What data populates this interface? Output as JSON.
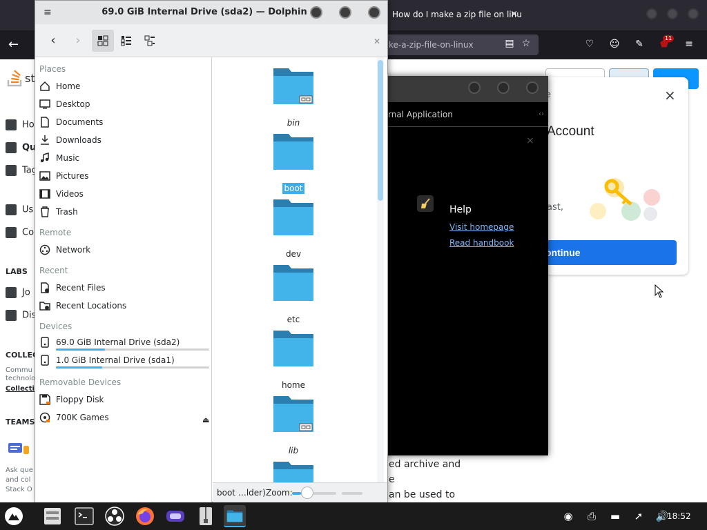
{
  "firefox": {
    "tab_title": "How do I make a zip file on linu",
    "tab_close": "×",
    "url_fragment": "ke-a-zip-file-on-linux",
    "extension_badge": "11",
    "back_arrow": "←"
  },
  "stackoverflow": {
    "logo_text": "st",
    "sidebar": [
      {
        "label": "Ho",
        "icon": "home-icon"
      },
      {
        "label": "Qu",
        "icon": "questions-icon"
      },
      {
        "label": "Tag",
        "icon": "tag-icon"
      },
      {
        "label": "Us",
        "icon": "users-icon"
      },
      {
        "label": "Co",
        "icon": "companies-icon"
      }
    ],
    "labs_heading": "LABS",
    "labs_items": [
      {
        "label": "Jo",
        "icon": "jobs-icon"
      },
      {
        "label": "Dis",
        "icon": "discussions-icon"
      }
    ],
    "collectives_heading": "COLLEC",
    "collectives_text": [
      "Commu",
      "technolo"
    ],
    "collectives_link": "Collecti",
    "teams_heading": "TEAMS",
    "teams_text": [
      "Ask que",
      "and col",
      "Stack O"
    ],
    "article_lines": [
      "ed archive and",
      "e",
      "an be used to"
    ]
  },
  "google_card": {
    "close": "×",
    "e_fragment": "e",
    "title": "Account",
    "text_fragment": "ast,",
    "continue_label": "ontinue",
    "accent": "#1a73e8"
  },
  "black_window": {
    "subtitle": "rnal Application",
    "arrows": "‹›",
    "close": "×",
    "help_heading": "Help",
    "links": [
      "Visit homepage",
      "Read handbook"
    ]
  },
  "dolphin": {
    "title": "69.0 GiB Internal Drive (sda2) — Dolphin",
    "menu_icon": "≡",
    "toolbar": {
      "back": "‹",
      "forward": "›"
    },
    "sidebar": {
      "places_heading": "Places",
      "places": [
        {
          "label": "Home",
          "icon": "home-folder-icon"
        },
        {
          "label": "Desktop",
          "icon": "desktop-icon"
        },
        {
          "label": "Documents",
          "icon": "documents-icon"
        },
        {
          "label": "Downloads",
          "icon": "downloads-icon"
        },
        {
          "label": "Music",
          "icon": "music-icon"
        },
        {
          "label": "Pictures",
          "icon": "pictures-icon"
        },
        {
          "label": "Videos",
          "icon": "videos-icon"
        },
        {
          "label": "Trash",
          "icon": "trash-icon"
        }
      ],
      "remote_heading": "Remote",
      "remote": [
        {
          "label": "Network",
          "icon": "network-icon"
        }
      ],
      "recent_heading": "Recent",
      "recent": [
        {
          "label": "Recent Files",
          "icon": "recent-files-icon"
        },
        {
          "label": "Recent Locations",
          "icon": "recent-locations-icon"
        }
      ],
      "devices_heading": "Devices",
      "devices": [
        {
          "label": "69.0 GiB Internal Drive (sda2)",
          "icon": "hard-drive-icon",
          "usage": 0.32
        },
        {
          "label": "1.0 GiB Internal Drive (sda1)",
          "icon": "hard-drive-icon",
          "usage": 0.3
        }
      ],
      "removable_heading": "Removable Devices",
      "removable": [
        {
          "label": "Floppy Disk",
          "icon": "floppy-icon"
        },
        {
          "label": "700K Games",
          "icon": "cdrom-icon"
        }
      ]
    },
    "folders": [
      {
        "name": "bin",
        "italic": true,
        "selected": false,
        "link": true
      },
      {
        "name": "boot",
        "italic": false,
        "selected": true,
        "link": false
      },
      {
        "name": "dev",
        "italic": false,
        "selected": false,
        "link": false
      },
      {
        "name": "etc",
        "italic": false,
        "selected": false,
        "link": false
      },
      {
        "name": "home",
        "italic": false,
        "selected": false,
        "link": false
      },
      {
        "name": "lib",
        "italic": true,
        "selected": false,
        "link": true
      },
      {
        "name": "",
        "italic": false,
        "selected": false,
        "link": false
      }
    ],
    "status": {
      "text": "boot …lder)",
      "zoom_label": "Zoom:",
      "zoom_level": 0.2
    },
    "colors": {
      "accent": "#3daee9",
      "folder_light": "#42b4ea",
      "folder_dark": "#2a7fb0"
    }
  },
  "taskbar": {
    "apps": [
      "launcher-icon",
      "file-manager-icon",
      "terminal-icon",
      "obs-icon",
      "firefox-icon",
      "game-icon",
      "archiver-icon",
      "dolphin-icon"
    ],
    "clock": "18:52"
  }
}
